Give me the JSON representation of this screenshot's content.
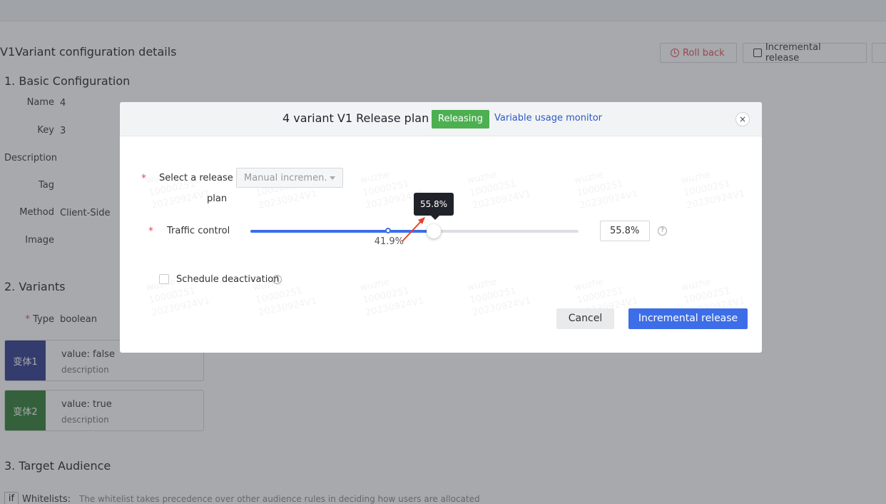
{
  "page": {
    "title": "V1Variant configuration details",
    "actions": {
      "rollback": "Roll back",
      "incremental": "Incremental release"
    }
  },
  "basic": {
    "heading": "1. Basic Configuration",
    "name_label": "Name",
    "name_value": "4",
    "key_label": "Key",
    "key_value": "3",
    "description_label": "Description",
    "tag_label": "Tag",
    "method_label": "Method",
    "method_value": "Client-Side",
    "image_label": "Image"
  },
  "variants": {
    "heading": "2. Variants",
    "type_label": "Type",
    "type_value": "boolean",
    "required_mark": "*",
    "items": [
      {
        "tag": "变体1",
        "value_label": "value:",
        "value": "false",
        "description": "description",
        "color": "#2d3a8c"
      },
      {
        "tag": "变体2",
        "value_label": "value:",
        "value": "true",
        "description": "description",
        "color": "#2e7d32"
      }
    ]
  },
  "audience": {
    "heading": "3. Target Audience",
    "if_label": "if",
    "whitelist_label": "Whitelists:",
    "whitelist_text": "The whitelist takes precedence over other audience rules in deciding how users are allocated"
  },
  "modal": {
    "title": "4 variant V1 Release plan",
    "status": "Releasing",
    "monitor_link": "Variable usage monitor",
    "close": "×",
    "required_mark": "*",
    "plan_label_line1": "Select a release",
    "plan_label_line2": "plan",
    "plan_value": "Manual incremen.",
    "traffic_label": "Traffic control",
    "traffic_current": 55.8,
    "traffic_previous": 41.9,
    "traffic_current_text": "55.8%",
    "traffic_previous_text": "41.9%",
    "help": "?",
    "schedule_label": "Schedule deactivation",
    "cancel": "Cancel",
    "submit": "Incremental release",
    "watermark_line1": "wuzhe",
    "watermark_line2": "10000251",
    "watermark_line3": "20230924V1",
    "accent_color": "#3d6ee8",
    "annotation_color": "#e8412c"
  }
}
